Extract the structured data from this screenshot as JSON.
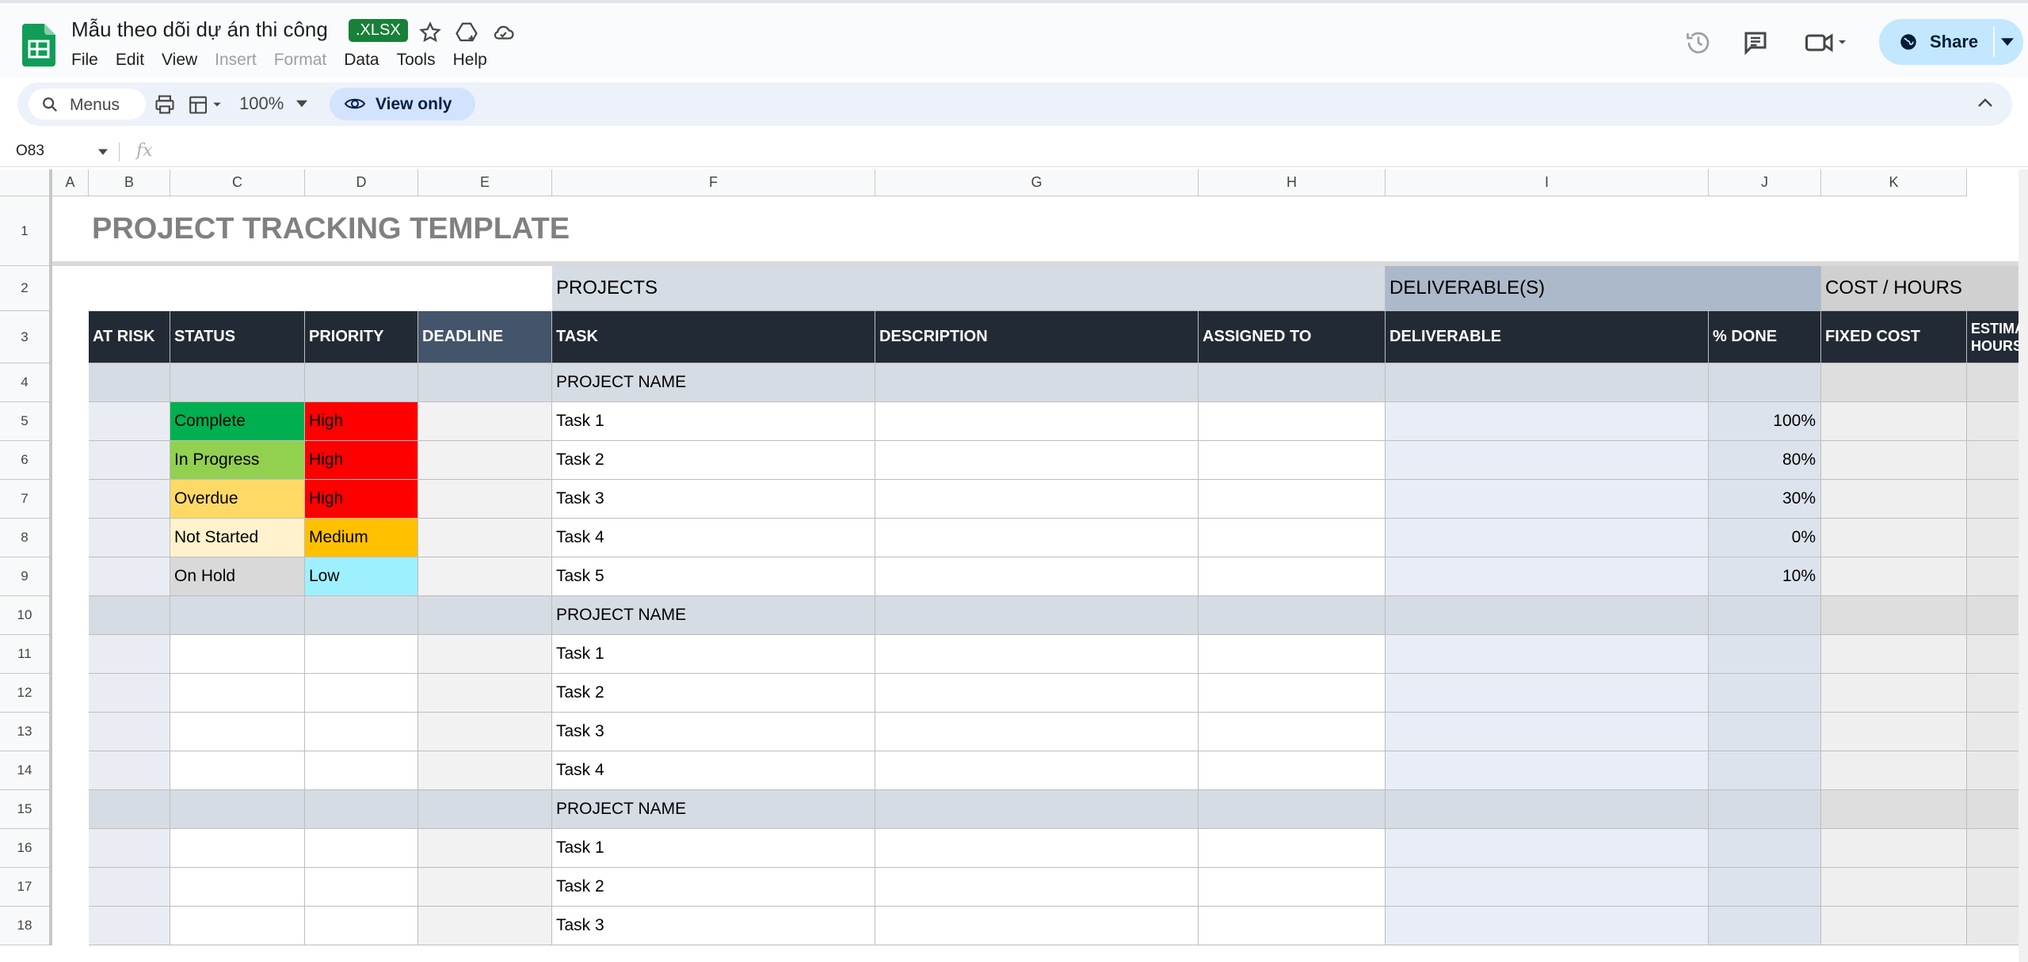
{
  "doc": {
    "title": "Mẫu theo dõi dự án thi công",
    "badge": ".XLSX",
    "menu": [
      "File",
      "Edit",
      "View",
      "Insert",
      "Format",
      "Data",
      "Tools",
      "Help"
    ],
    "menu_disabled": [
      "Insert",
      "Format"
    ],
    "share_label": "Share"
  },
  "toolbar": {
    "search_label": "Menus",
    "zoom": "100%",
    "view_only_label": "View only"
  },
  "formula_bar": {
    "name_box": "O83",
    "fx": "fx"
  },
  "columns": [
    "A",
    "B",
    "C",
    "D",
    "E",
    "F",
    "G",
    "H",
    "I",
    "J",
    "K"
  ],
  "rows": [
    "1",
    "2",
    "3",
    "4",
    "5",
    "6",
    "7",
    "8",
    "9",
    "10",
    "11",
    "12",
    "13",
    "14",
    "15",
    "16",
    "17",
    "18"
  ],
  "sheet": {
    "title": "PROJECT TRACKING TEMPLATE",
    "section_projects": "PROJECTS",
    "section_deliverables": "DELIVERABLE(S)",
    "section_cost": "COST / HOURS",
    "headers": {
      "at_risk": "AT RISK",
      "status": "STATUS",
      "priority": "PRIORITY",
      "deadline": "DEADLINE",
      "task": "TASK",
      "description": "DESCRIPTION",
      "assigned_to": "ASSIGNED TO",
      "deliverable": "DELIVERABLE",
      "pct_done": "% DONE",
      "fixed_cost": "FIXED COST",
      "estimated_hours_1": "ESTIMA",
      "estimated_hours_2": "HOURS"
    },
    "project_name": "PROJECT NAME",
    "group1": [
      {
        "status": "Complete",
        "priority": "High",
        "task": "Task 1",
        "done": "100%"
      },
      {
        "status": "In Progress",
        "priority": "High",
        "task": "Task 2",
        "done": "80%"
      },
      {
        "status": "Overdue",
        "priority": "High",
        "task": "Task 3",
        "done": "30%"
      },
      {
        "status": "Not Started",
        "priority": "Medium",
        "task": "Task 4",
        "done": "0%"
      },
      {
        "status": "On Hold",
        "priority": "Low",
        "task": "Task 5",
        "done": "10%"
      }
    ],
    "group2": [
      "Task 1",
      "Task 2",
      "Task 3",
      "Task 4"
    ],
    "group3": [
      "Task 1",
      "Task 2",
      "Task 3"
    ]
  },
  "colors": {
    "header_dark": "#222b35",
    "deadline_header": "#44546a",
    "section_projects": "#d5dce4",
    "section_deliverables": "#acb9ca",
    "section_cost": "#d0d0d0",
    "complete": "#00b050",
    "in_progress": "#92d050",
    "overdue": "#ffd966",
    "not_started": "#fff2cc",
    "on_hold": "#d9d9d9",
    "high": "#ff0000",
    "medium": "#ffc000",
    "low": "#9ff0ff"
  }
}
